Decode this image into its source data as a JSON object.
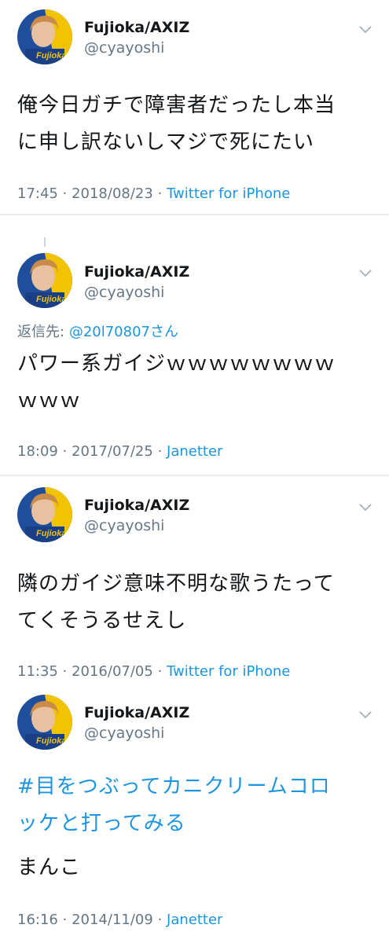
{
  "tweets": [
    {
      "display_name": "Fujioka/AXIZ",
      "handle": "@cyayoshi",
      "text_lines": [
        "俺今日ガチで障害者だったし本当",
        "に申し訳ないしマジで死にたい"
      ],
      "time": "17:45",
      "date": "2018/08/23",
      "separator": "·",
      "source": "Twitter for iPhone"
    },
    {
      "display_name": "Fujioka/AXIZ",
      "handle": "@cyayoshi",
      "reply_prefix": "返信先:",
      "reply_mention": "@20l70807さん",
      "text_lines": [
        "パワー系ガイジｗｗｗｗｗｗｗｗ",
        "ｗｗｗ"
      ],
      "time": "18:09",
      "date": "2017/07/25",
      "separator": "·",
      "source": "Janetter"
    },
    {
      "display_name": "Fujioka/AXIZ",
      "handle": "@cyayoshi",
      "text_lines": [
        "隣のガイジ意味不明な歌うたって",
        "てくそうるせえし"
      ],
      "time": "11:35",
      "date": "2016/07/05",
      "separator": "·",
      "source": "Twitter for iPhone"
    },
    {
      "display_name": "Fujioka/AXIZ",
      "handle": "@cyayoshi",
      "hashtag_lines": [
        "#目をつぶってカニクリームコロ",
        "ッケと打ってみる"
      ],
      "text_lines": [
        "まんこ"
      ],
      "time": "16:16",
      "date": "2014/11/09",
      "separator": "·",
      "source": "Janetter"
    }
  ],
  "avatar_text": "Fujioka",
  "colors": {
    "text": "#14171a",
    "secondary": "#657786",
    "link": "#1b95e0",
    "divider": "#e6ecf0"
  },
  "icons": {
    "menu": "chevron-down-icon",
    "avatar": "user-avatar"
  }
}
